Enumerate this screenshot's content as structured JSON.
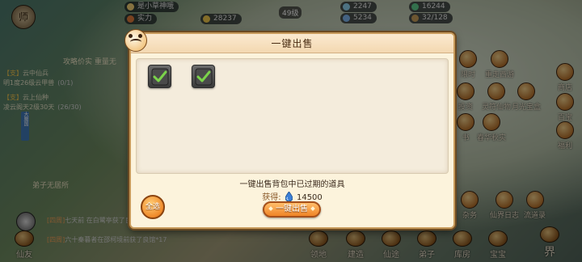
{
  "hud": {
    "player_name": "是小草神哦",
    "stamina": "2247",
    "gem": "16244",
    "power": "实力",
    "power_value": "28237",
    "silver": "5234",
    "bag": "32/128",
    "level": "49级",
    "top_left_label": "师"
  },
  "left_panel": {
    "notice": "攻略价实 重量无",
    "quests": [
      {
        "tag": "【支】",
        "title": "云中仙兵",
        "detail": "明1度26级云甲兽",
        "progress": "(0/1)"
      },
      {
        "tag": "【支】",
        "title": "云上仙种",
        "detail": "凌云阁天2级30天",
        "progress": "(26/30)"
      }
    ],
    "vertical_tab": "大魔国",
    "location": "弟子无居所"
  },
  "chat": [
    {
      "prefix": "[四周]",
      "body": "七天前 在白鹭亭获了良馆*16"
    },
    {
      "prefix": "[四周]",
      "body": "六十秦暮者在邵柯境前获了良馆*17"
    }
  ],
  "right_menu": {
    "items": [
      "限时",
      "重走西游",
      "投资",
      "灵符仙物",
      "月光宝盒",
      "商店",
      "百宝",
      "福利",
      "春华秋实",
      "书"
    ],
    "bottom_items": [
      "杂务",
      "仙界日志",
      "流道录"
    ]
  },
  "bottom_nav": [
    "仙友",
    "领地",
    "建造",
    "仙途",
    "弟子",
    "库房",
    "宝宝",
    "界"
  ],
  "modal": {
    "title": "一键出售",
    "items": [
      {
        "name": "expired-item-1",
        "checked": true
      },
      {
        "name": "expired-item-2",
        "checked": true
      }
    ],
    "description": "一键出售背包中已过期的道具",
    "gain_label": "获得:",
    "gain_value": "14500",
    "select_all_label": "全选",
    "sell_button_label": "一键出售"
  },
  "colors": {
    "accent": "#f08426",
    "panel": "#fcf3dc",
    "check": "#7bd34a"
  }
}
